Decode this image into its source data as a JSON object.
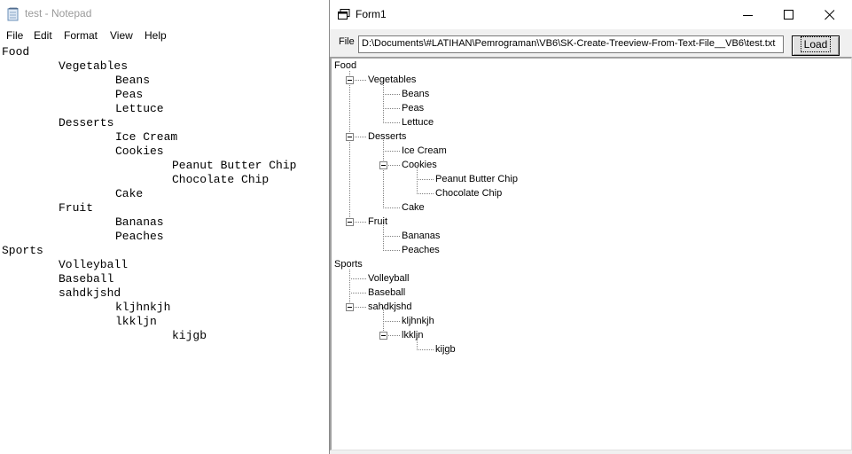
{
  "notepad": {
    "title": "test - Notepad",
    "menu": [
      "File",
      "Edit",
      "Format",
      "View",
      "Help"
    ],
    "lines": [
      {
        "text": "Food",
        "depth": 0
      },
      {
        "text": "Vegetables",
        "depth": 1
      },
      {
        "text": "Beans",
        "depth": 2
      },
      {
        "text": "Peas",
        "depth": 2
      },
      {
        "text": "Lettuce",
        "depth": 2
      },
      {
        "text": "Desserts",
        "depth": 1
      },
      {
        "text": "Ice Cream",
        "depth": 2
      },
      {
        "text": "Cookies",
        "depth": 2
      },
      {
        "text": "Peanut Butter Chip",
        "depth": 3
      },
      {
        "text": "Chocolate Chip",
        "depth": 3
      },
      {
        "text": "Cake",
        "depth": 2
      },
      {
        "text": "Fruit",
        "depth": 1
      },
      {
        "text": "Bananas",
        "depth": 2
      },
      {
        "text": "Peaches",
        "depth": 2
      },
      {
        "text": "Sports",
        "depth": 0
      },
      {
        "text": "Volleyball",
        "depth": 1
      },
      {
        "text": "Baseball",
        "depth": 1
      },
      {
        "text": "sahdkjshd",
        "depth": 1
      },
      {
        "text": "kljhnkjh",
        "depth": 2
      },
      {
        "text": "lkkljn",
        "depth": 2
      },
      {
        "text": "kijgb",
        "depth": 3
      }
    ]
  },
  "form1": {
    "title": "Form1",
    "file_label": "File",
    "file_path": "D:\\Documents\\#LATIHAN\\Pemrograman\\VB6\\SK-Create-Treeview-From-Text-File__VB6\\test.txt",
    "load_label": "Load",
    "tree": [
      {
        "text": "Food",
        "depth": 0,
        "expanded": true
      },
      {
        "text": "Vegetables",
        "depth": 1,
        "expanded": true
      },
      {
        "text": "Beans",
        "depth": 2
      },
      {
        "text": "Peas",
        "depth": 2
      },
      {
        "text": "Lettuce",
        "depth": 2
      },
      {
        "text": "Desserts",
        "depth": 1,
        "expanded": true
      },
      {
        "text": "Ice Cream",
        "depth": 2
      },
      {
        "text": "Cookies",
        "depth": 2,
        "expanded": true
      },
      {
        "text": "Peanut Butter Chip",
        "depth": 3
      },
      {
        "text": "Chocolate Chip",
        "depth": 3
      },
      {
        "text": "Cake",
        "depth": 2
      },
      {
        "text": "Fruit",
        "depth": 1,
        "expanded": true
      },
      {
        "text": "Bananas",
        "depth": 2
      },
      {
        "text": "Peaches",
        "depth": 2
      },
      {
        "text": "Sports",
        "depth": 0,
        "expanded": true
      },
      {
        "text": "Volleyball",
        "depth": 1
      },
      {
        "text": "Baseball",
        "depth": 1
      },
      {
        "text": "sahdkjshd",
        "depth": 1,
        "expanded": true
      },
      {
        "text": "kljhnkjh",
        "depth": 2
      },
      {
        "text": "lkkljn",
        "depth": 2,
        "expanded": true
      },
      {
        "text": "kijgb",
        "depth": 3
      }
    ]
  }
}
